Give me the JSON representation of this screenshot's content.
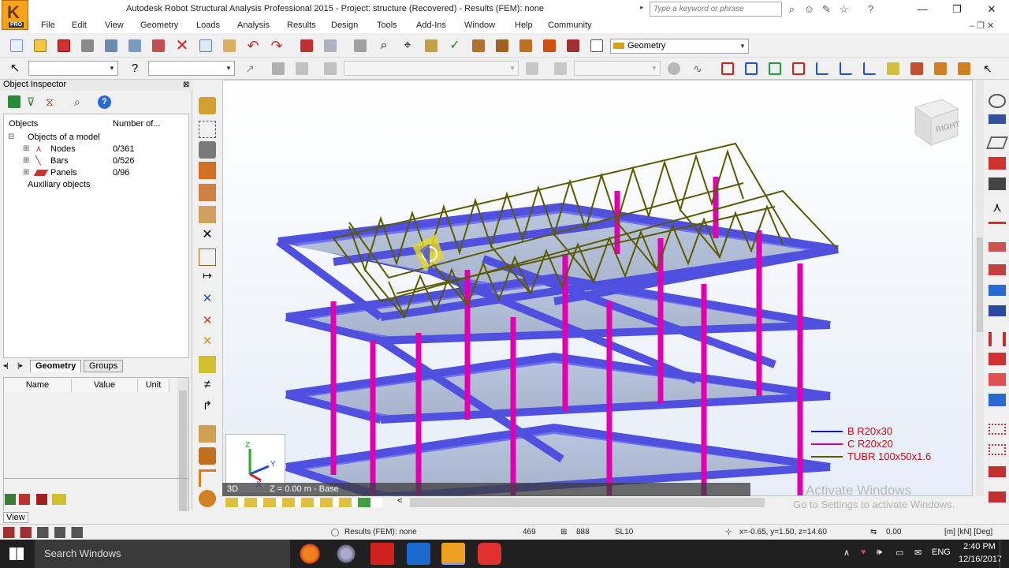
{
  "app": {
    "logo_text": "K",
    "logo_badge": "PRO",
    "title": "Autodesk Robot Structural Analysis Professional 2015 - Project: structure (Recovered) - Results (FEM): none",
    "search_placeholder": "Type a keyword or phrase"
  },
  "menu": [
    "File",
    "Edit",
    "View",
    "Geometry",
    "Loads",
    "Analysis",
    "Results",
    "Design",
    "Tools",
    "Add-Ins",
    "Window",
    "Help",
    "Community"
  ],
  "toolbar": {
    "layout_combo": "Geometry"
  },
  "object_inspector": {
    "title": "Object Inspector",
    "col_objects": "Objects",
    "col_number": "Number of...",
    "root": "Objects of a model",
    "items": [
      {
        "label": "Nodes",
        "count": "0/361"
      },
      {
        "label": "Bars",
        "count": "0/526"
      },
      {
        "label": "Panels",
        "count": "0/96"
      }
    ],
    "aux": "Auxiliary objects",
    "tabs": [
      "Geometry",
      "Groups"
    ],
    "prop_cols": [
      "Name",
      "Value",
      "Unit"
    ]
  },
  "viewport": {
    "cube_label": "RIGHT",
    "legend": [
      {
        "label": "B R20x30",
        "color": "#1a1aa0"
      },
      {
        "label": "C R20x20",
        "color": "#d000a0"
      },
      {
        "label": "TUBR 100x50x1.6",
        "color": "#5a5a00"
      }
    ],
    "view_mode": "3D",
    "level": "Z = 0.00 m - Base",
    "watermark1": "Activate Windows",
    "watermark2": "Go to Settings to activate Windows."
  },
  "status": {
    "view_tab": "View",
    "results": "Results (FEM): none",
    "num1": "469",
    "num2": "888",
    "section": "SL10",
    "coords": "x=-0.65, y=1.50, z=14.60",
    "value": "0.00",
    "units": "[m] [kN] [Deg]"
  },
  "taskbar": {
    "search": "Search Windows",
    "lang": "ENG",
    "time": "2:40 PM",
    "date": "12/16/2017"
  },
  "colors": {
    "slab": "#7878ff",
    "column": "#d000a0",
    "truss": "#5a5a00"
  }
}
